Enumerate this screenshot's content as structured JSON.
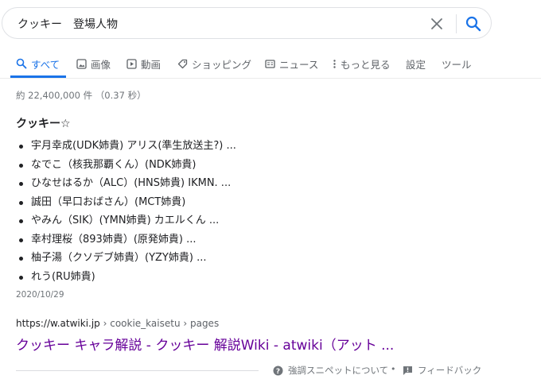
{
  "search": {
    "query": "クッキー　登場人物"
  },
  "tabs": [
    {
      "label": "すべて",
      "icon": "search-icon",
      "active": true
    },
    {
      "label": "画像",
      "icon": "image-icon",
      "active": false
    },
    {
      "label": "動画",
      "icon": "video-icon",
      "active": false
    },
    {
      "label": "ショッピング",
      "icon": "tag-icon",
      "active": false
    },
    {
      "label": "ニュース",
      "icon": "news-icon",
      "active": false
    },
    {
      "label": "もっと見る",
      "icon": "more-vert-icon",
      "active": false
    },
    {
      "label": "設定",
      "icon": "",
      "active": false
    },
    {
      "label": "ツール",
      "icon": "",
      "active": false
    }
  ],
  "stats": {
    "text": "約 22,400,000 件 （0.37 秒）"
  },
  "snippet": {
    "title": "クッキー☆",
    "items": [
      "宇月幸成(UDK姉貴) アリス(準生放送主?) ...",
      "なでこ（核我那覇くん）(NDK姉貴)",
      "ひなせはるか（ALC）(HNS姉貴) IKMN. ...",
      "誠田（早口おばさん）(MCT姉貴)",
      "やみん（SIK）(YMN姉貴) カエルくん ...",
      "幸村理桜（893姉貴）(原発姉貴) ...",
      "柚子湯（クソデブ姉貴）(YZY姉貴) ...",
      "れう(RU姉貴)"
    ],
    "date": "2020/10/29"
  },
  "result": {
    "domain": "https://w.atwiki.jp",
    "breadcrumb": " › cookie_kaisetu › pages",
    "title": "クッキー キャラ解説 - クッキー 解説Wiki - atwiki（アット ..."
  },
  "footer": {
    "about_label": "強調スニペットについて",
    "dot": "•",
    "feedback_label": "フィードバック"
  },
  "colors": {
    "accent": "#1a73e8",
    "visited_link": "#660099",
    "muted": "#70757a"
  }
}
